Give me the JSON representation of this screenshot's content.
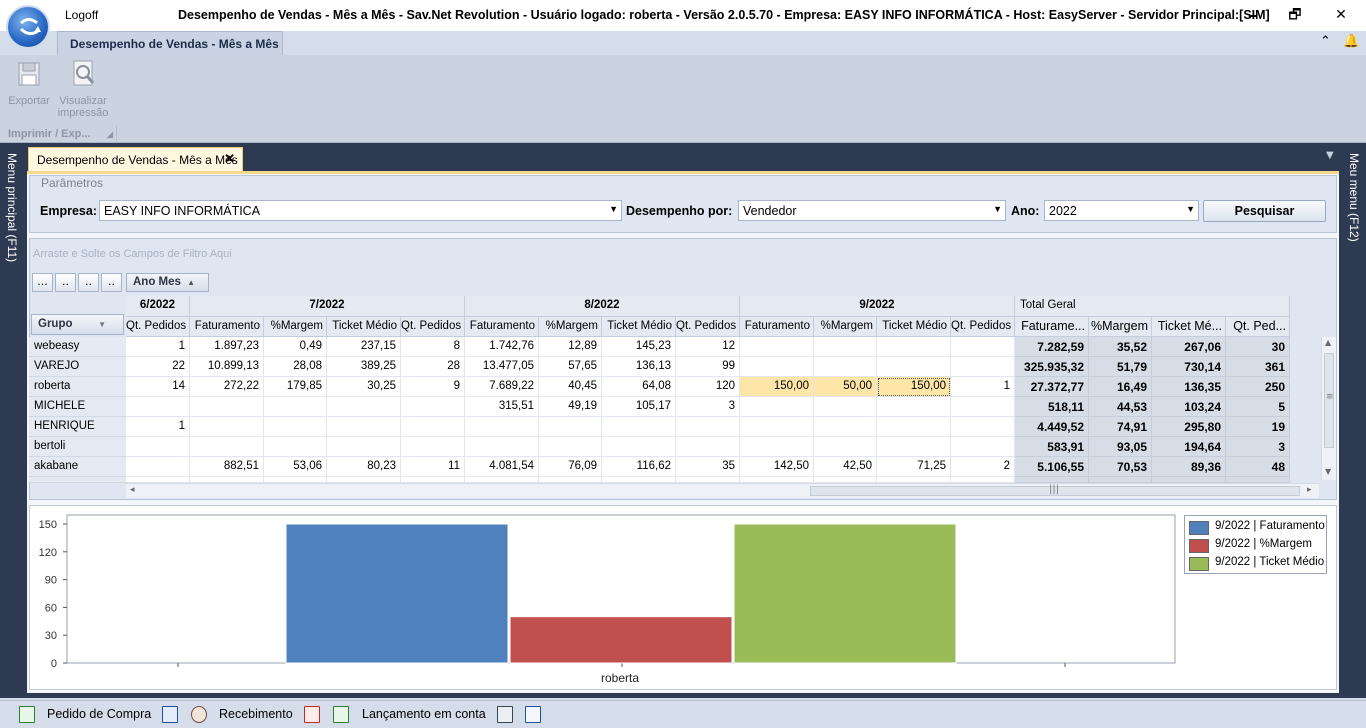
{
  "window": {
    "logoff_label": "Logoff",
    "title": "Desempenho de Vendas - Mês a Mês - Sav.Net Revolution - Usuário logado: roberta - Versão 2.0.5.70 - Empresa: EASY INFO INFORMÁTICA - Host: EasyServer - Servidor Principal:[SIM]",
    "minimize": "🗕",
    "maximize": "🗗",
    "close": "✕"
  },
  "ribbon": {
    "tab_label": "Desempenho de Vendas - Mês a Mês",
    "collapse_glyph": "⌃",
    "bell_glyph": "🔔",
    "export_label": "Exportar",
    "preview_label": "Visualizar impressão",
    "group_label": "Imprimir / Exp..."
  },
  "sidebars": {
    "left_label": "Menu principal (F11)",
    "right_label": "Meu menu (F12)"
  },
  "document": {
    "tab_label": "Desempenho de Vendas - Mês a Mês",
    "close_glyph": "✕"
  },
  "params": {
    "legend": "Parâmetros",
    "empresa_label": "Empresa:",
    "empresa_value": "EASY INFO INFORMÁTICA",
    "desempenho_label": "Desempenho por:",
    "desempenho_value": "Vendedor",
    "ano_label": "Ano:",
    "ano_value": "2022",
    "search_button": "Pesquisar",
    "dropdown_glyph": "▼"
  },
  "pivot": {
    "filter_hint": "Arraste e Solte os Campos de Filtro Aqui",
    "small_buttons": [
      "...",
      "..",
      "..",
      ".."
    ],
    "column_field": "Ano Mes",
    "row_field": "Grupo",
    "months": [
      "6/2022",
      "7/2022",
      "8/2022",
      "9/2022"
    ],
    "total_label": "Total Geral",
    "measures": {
      "qt": "Qt. Pedidos",
      "fat": "Faturamento",
      "mar": "%Margem",
      "tic": "Ticket Médio"
    },
    "total_measures": {
      "fat": "Faturame...",
      "mar": "%Margem",
      "tic": "Ticket Mé...",
      "qt": "Qt. Ped..."
    },
    "rows": [
      {
        "label": "webeasy",
        "c": [
          "1",
          "1.897,23",
          "0,49",
          "237,15",
          "8",
          "1.742,76",
          "12,89",
          "145,23",
          "12",
          "",
          "",
          "",
          "",
          "7.282,59",
          "35,52",
          "267,06",
          "30"
        ]
      },
      {
        "label": "VAREJO",
        "c": [
          "22",
          "10.899,13",
          "28,08",
          "389,25",
          "28",
          "13.477,05",
          "57,65",
          "136,13",
          "99",
          "",
          "",
          "",
          "",
          "325.935,32",
          "51,79",
          "730,14",
          "361"
        ]
      },
      {
        "label": "roberta",
        "c": [
          "14",
          "272,22",
          "179,85",
          "30,25",
          "9",
          "7.689,22",
          "40,45",
          "64,08",
          "120",
          "150,00",
          "50,00",
          "150,00",
          "1",
          "27.372,77",
          "16,49",
          "136,35",
          "250"
        ]
      },
      {
        "label": "MICHELE",
        "c": [
          "",
          "",
          "",
          "",
          "",
          "315,51",
          "49,19",
          "105,17",
          "3",
          "",
          "",
          "",
          "",
          "518,11",
          "44,53",
          "103,24",
          "5"
        ]
      },
      {
        "label": "HENRIQUE",
        "c": [
          "1",
          "",
          "",
          "",
          "",
          "",
          "",
          "",
          "",
          "",
          "",
          "",
          "",
          "4.449,52",
          "74,91",
          "295,80",
          "19"
        ]
      },
      {
        "label": "bertoli",
        "c": [
          "",
          "",
          "",
          "",
          "",
          "",
          "",
          "",
          "",
          "",
          "",
          "",
          "",
          "583,91",
          "93,05",
          "194,64",
          "3"
        ]
      },
      {
        "label": "akabane",
        "c": [
          "",
          "882,51",
          "53,06",
          "80,23",
          "11",
          "4.081,54",
          "76,09",
          "116,62",
          "35",
          "142,50",
          "42,50",
          "71,25",
          "2",
          "5.106,55",
          "70,53",
          "89,36",
          "48"
        ]
      }
    ]
  },
  "chart_data": {
    "type": "bar",
    "categories": [
      "roberta"
    ],
    "series": [
      {
        "name": "9/2022 | Faturamento",
        "values": [
          150.0
        ],
        "color": "#4f81bd"
      },
      {
        "name": "9/2022 | %Margem",
        "values": [
          50.0
        ],
        "color": "#c0504d"
      },
      {
        "name": "9/2022 | Ticket Médio",
        "values": [
          150.0
        ],
        "color": "#9bbb59"
      }
    ],
    "ylim": [
      0,
      150
    ],
    "yticks": [
      "0",
      "30",
      "60",
      "90",
      "120",
      "150"
    ],
    "grid": false,
    "legend_position": "top-right"
  },
  "bottombar": {
    "items": [
      "Pedido de Compra",
      "Recebimento",
      "Lançamento em conta"
    ]
  }
}
